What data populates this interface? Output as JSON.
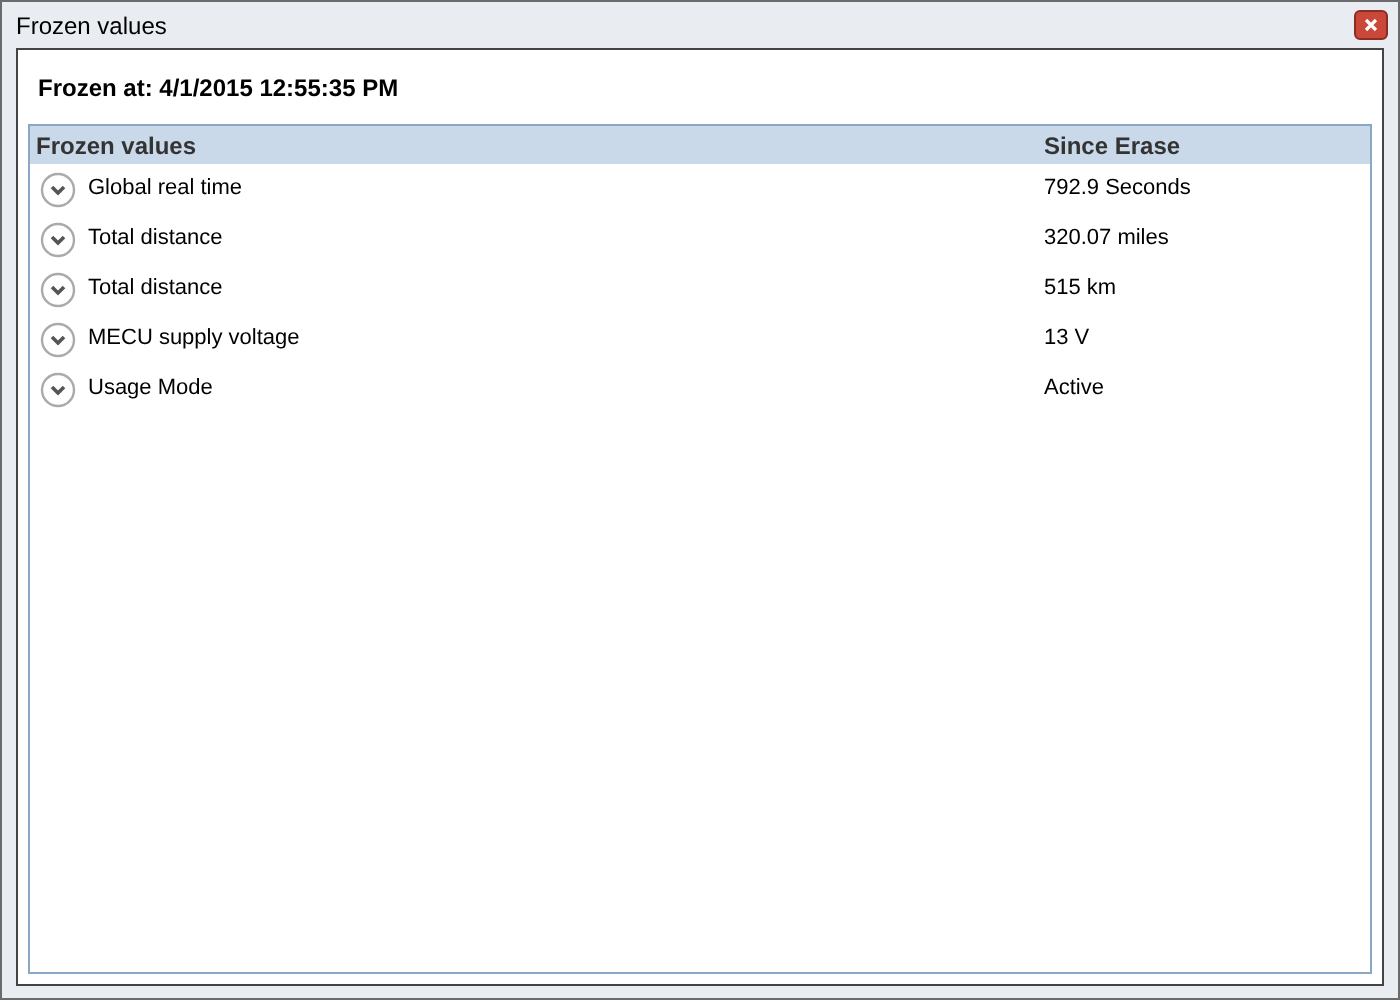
{
  "window": {
    "title": "Frozen values"
  },
  "frozen_at": "Frozen at: 4/1/2015 12:55:35 PM",
  "table": {
    "columns": [
      "Frozen values",
      "Since Erase"
    ],
    "rows": [
      {
        "name": "Global real time",
        "value": "792.9 Seconds"
      },
      {
        "name": "Total distance",
        "value": "320.07 miles"
      },
      {
        "name": "Total distance",
        "value": "515 km"
      },
      {
        "name": "MECU supply voltage",
        "value": "13 V"
      },
      {
        "name": "Usage Mode",
        "value": "Active"
      }
    ]
  }
}
